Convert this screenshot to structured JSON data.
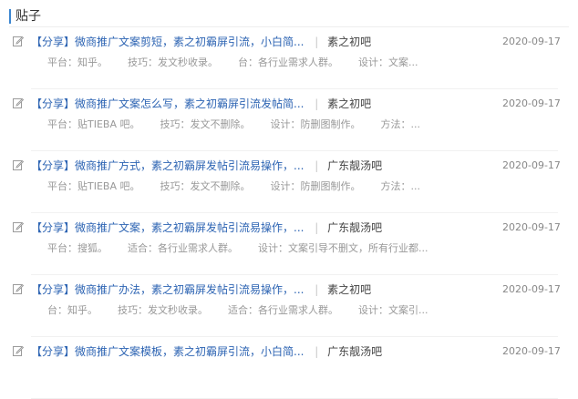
{
  "section": {
    "title": "贴子"
  },
  "posts": [
    {
      "title": "【分享】微商推广文案剪短，素之初霸屏引流，小白简...",
      "forum": "素之初吧",
      "date": "2020-09-17",
      "meta": [
        "平台：知乎。",
        "技巧：发文秒收录。",
        "台：各行业需求人群。",
        "设计：文案..."
      ]
    },
    {
      "title": "【分享】微商推广文案怎么写，素之初霸屏引流发帖简...",
      "forum": "素之初吧",
      "date": "2020-09-17",
      "meta": [
        "平台：贴TIEBA 吧。",
        "技巧：发文不删除。",
        "设计：防删图制作。",
        "方法：..."
      ]
    },
    {
      "title": "【分享】微商推广方式，素之初霸屏发帖引流易操作，...",
      "forum": "广东靓汤吧",
      "date": "2020-09-17",
      "meta": [
        "平台：贴TIEBA 吧。",
        "技巧：发文不删除。",
        "设计：防删图制作。",
        "方法：..."
      ]
    },
    {
      "title": "【分享】微商推广文案，素之初霸屏发帖引流易操作，...",
      "forum": "广东靓汤吧",
      "date": "2020-09-17",
      "meta": [
        "平台：搜狐。",
        "适合：各行业需求人群。",
        "设计：文案引导不删文，所有行业都..."
      ]
    },
    {
      "title": "【分享】微商推广办法，素之初霸屏发帖引流易操作，...",
      "forum": "素之初吧",
      "date": "2020-09-17",
      "meta": [
        "台：知乎。",
        "技巧：发文秒收录。",
        "适合：各行业需求人群。",
        "设计：文案引..."
      ]
    },
    {
      "title": "【分享】微商推广文案模板，素之初霸屏引流，小白简...",
      "forum": "广东靓汤吧",
      "date": "2020-09-17",
      "meta": []
    }
  ],
  "icons": {
    "post_icon": "edit-icon"
  },
  "colors": {
    "accent": "#3b86d1",
    "title_link": "#2d64b3",
    "meta_text": "#999999",
    "date_text": "#888888"
  }
}
